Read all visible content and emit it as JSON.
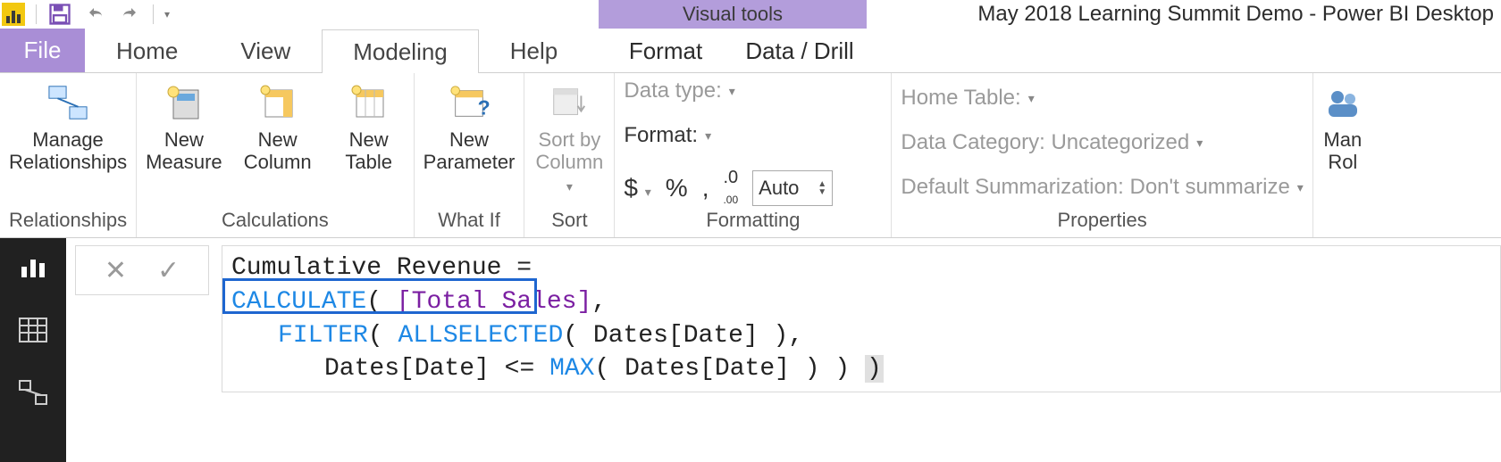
{
  "title": {
    "contextual_tools": "Visual tools",
    "window_title": "May 2018 Learning Summit Demo - Power BI Desktop"
  },
  "tabs": {
    "file": "File",
    "home": "Home",
    "view": "View",
    "modeling": "Modeling",
    "help": "Help",
    "format": "Format",
    "data_drill": "Data / Drill"
  },
  "ribbon": {
    "relationships": {
      "manage": "Manage\nRelationships",
      "group": "Relationships"
    },
    "calculations": {
      "new_measure": "New\nMeasure",
      "new_column": "New\nColumn",
      "new_table": "New\nTable",
      "group": "Calculations"
    },
    "whatif": {
      "new_parameter": "New\nParameter",
      "group": "What If"
    },
    "sort": {
      "sort_by_column": "Sort by\nColumn",
      "group": "Sort"
    },
    "formatting": {
      "data_type": "Data type:",
      "format": "Format:",
      "auto": "Auto",
      "group": "Formatting"
    },
    "properties": {
      "home_table": "Home Table:",
      "data_category": "Data Category: Uncategorized",
      "default_summarization": "Default Summarization: Don't summarize",
      "group": "Properties"
    },
    "security": {
      "manage_roles": "Man\nRol"
    }
  },
  "formula": {
    "line1": "Cumulative Revenue =",
    "calc": "CALCULATE",
    "total_sales": "[Total Sales]",
    "filter": "FILTER",
    "allselected": "ALLSELECTED",
    "dates_date": "Dates[Date]",
    "max": "MAX"
  }
}
